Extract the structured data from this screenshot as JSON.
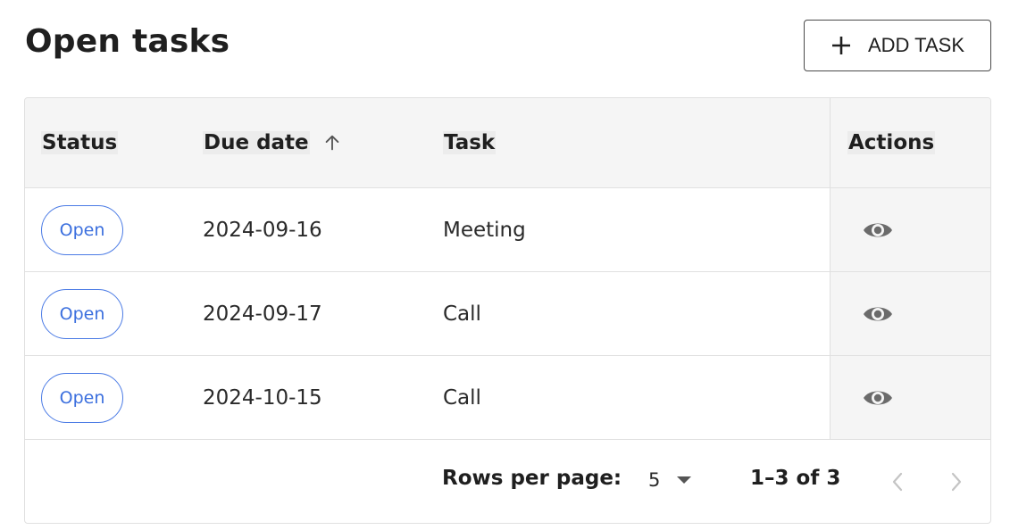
{
  "header": {
    "title": "Open tasks",
    "add_button_label": "ADD TASK",
    "add_icon": "plus-icon"
  },
  "table": {
    "columns": {
      "status": "Status",
      "due_date": "Due date",
      "task": "Task",
      "actions": "Actions"
    },
    "sort": {
      "column": "Due date",
      "direction": "ascending",
      "icon": "arrow-up-icon"
    },
    "rows": [
      {
        "status": "Open",
        "due_date": "2024-09-16",
        "task": "Meeting",
        "action_icon": "eye-icon"
      },
      {
        "status": "Open",
        "due_date": "2024-09-17",
        "task": "Call",
        "action_icon": "eye-icon"
      },
      {
        "status": "Open",
        "due_date": "2024-10-15",
        "task": "Call",
        "action_icon": "eye-icon"
      }
    ]
  },
  "pagination": {
    "rows_per_page_label": "Rows per page:",
    "rows_per_page_value": "5",
    "range_text": "1–3 of 3",
    "prev_icon": "chevron-left-icon",
    "next_icon": "chevron-right-icon"
  },
  "colors": {
    "chip_accent": "#3b6fde",
    "header_bg": "#f5f5f5",
    "border": "#e0e0e0",
    "icon_gray": "#6b6b6b"
  }
}
